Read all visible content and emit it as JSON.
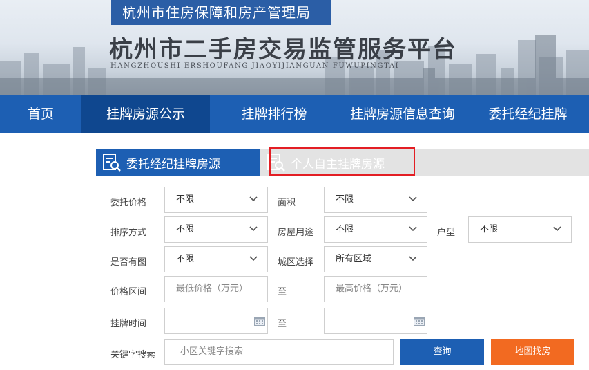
{
  "banner": {
    "bureau": "杭州市住房保障和房产管理局",
    "platform_title": "杭州市二手房交易监管服务平台",
    "platform_pinyin": "HANGZHOUSHI  ERSHOUFANG  JIAOYIJIANGUAN  FUWUPINGTAI"
  },
  "nav": {
    "items": [
      {
        "label": "首页",
        "active": false
      },
      {
        "label": "挂牌房源公示",
        "active": true
      },
      {
        "label": "挂牌排行榜",
        "active": false
      },
      {
        "label": "挂牌房源信息查询",
        "active": false
      },
      {
        "label": "委托经纪挂牌",
        "active": false
      }
    ]
  },
  "source_tabs": {
    "agent": "委托经纪挂牌房源",
    "individual": "个人自主挂牌房源"
  },
  "filters": {
    "commission_price": {
      "label": "委托价格",
      "value": "不限"
    },
    "area": {
      "label": "面积",
      "value": "不限"
    },
    "sort": {
      "label": "排序方式",
      "value": "不限"
    },
    "usage": {
      "label": "房屋用途",
      "value": "不限"
    },
    "layout": {
      "label": "户型",
      "value": "不限"
    },
    "has_image": {
      "label": "是否有图",
      "value": "不限"
    },
    "district": {
      "label": "城区选择",
      "value": "所有区域"
    },
    "price_range": {
      "label": "价格区间",
      "min_placeholder": "最低价格（万元）",
      "to": "至",
      "max_placeholder": "最高价格（万元）"
    },
    "listing_time": {
      "label": "挂牌时间",
      "to": "至"
    },
    "keyword": {
      "label": "关键字搜索",
      "placeholder": "小区关键字搜索"
    }
  },
  "buttons": {
    "query": "查询",
    "map_search": "地图找房"
  },
  "colors": {
    "primary_blue": "#1d5fb3",
    "active_nav": "#0f478f",
    "orange": "#f26a21",
    "highlight_red": "#e31e24"
  }
}
